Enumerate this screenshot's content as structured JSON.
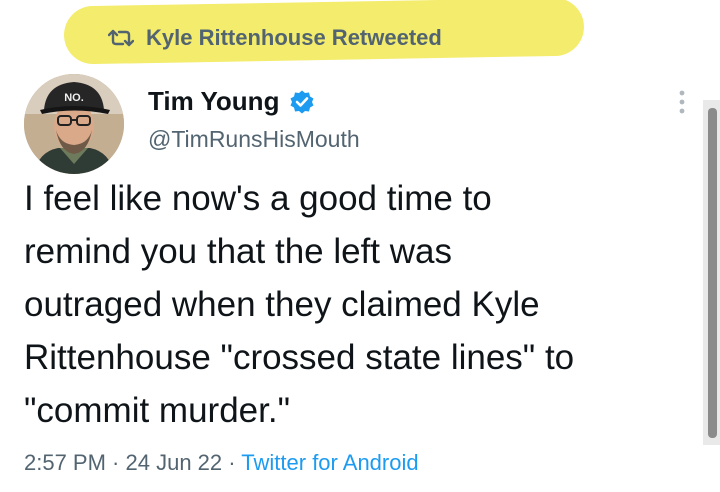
{
  "retweet": {
    "label": "Kyle Rittenhouse Retweeted",
    "icon": "retweet-icon"
  },
  "author": {
    "display_name": "Tim Young",
    "handle": "@TimRunsHisMouth",
    "verified": true,
    "verified_color": "#1d9bf0",
    "avatar_cap_text": "NO."
  },
  "tweet": {
    "text": "I feel like now's a good time to\nremind you that the left was\noutraged when they claimed Kyle\nRittenhouse \"crossed state lines\" to\n\"commit murder.\""
  },
  "meta": {
    "time": "2:57 PM",
    "separator": " · ",
    "date": "24 Jun 22",
    "source": "Twitter for Android"
  },
  "colors": {
    "highlight": "#f3ec6c",
    "secondary_text": "#536471",
    "primary_text": "#0f1419"
  }
}
